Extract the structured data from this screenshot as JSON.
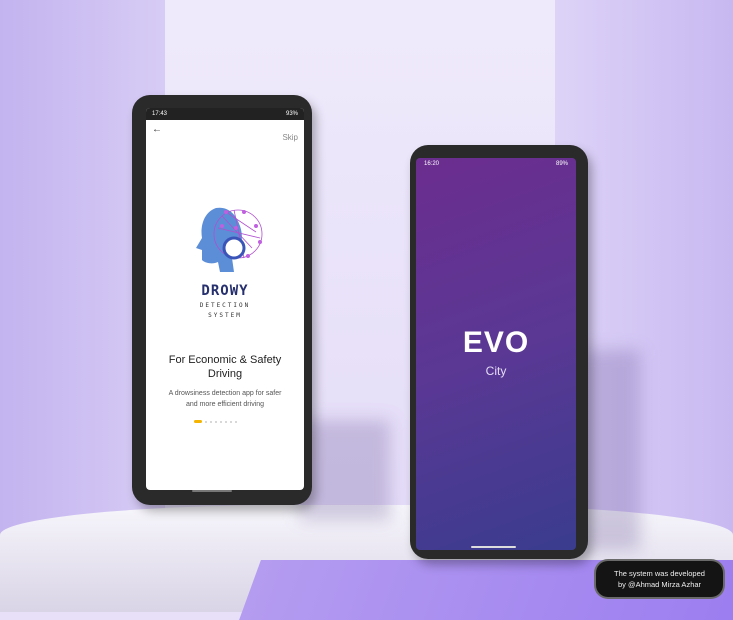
{
  "phone1": {
    "status": {
      "time": "17:43",
      "battery": "93%"
    },
    "skip_label": "Skip",
    "back_icon": "back-arrow-icon",
    "logo": {
      "title": "DROWY",
      "line1": "DETECTION",
      "line2": "SYSTEM"
    },
    "headline": "For Economic & Safety Driving",
    "description": "A drowsiness detection app for safer and more efficient driving",
    "pager": {
      "active_index": 0,
      "count": 8
    }
  },
  "phone2": {
    "status": {
      "time": "16:20",
      "battery": "89%"
    },
    "logo": {
      "title": "EVO",
      "subtitle": "City"
    }
  },
  "credit": {
    "line1": "The system was developed",
    "line2": "by @Ahmad Mirza Azhar"
  },
  "colors": {
    "accent_gold": "#f4b400",
    "brand_navy": "#27306e",
    "evo_gradient_start": "#6b2d8f",
    "evo_gradient_end": "#3a3c8e"
  }
}
